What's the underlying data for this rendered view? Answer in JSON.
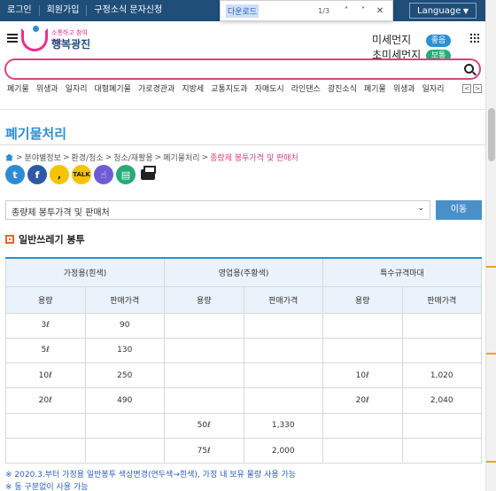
{
  "topbar": {
    "links": [
      "로그인",
      "회원가입",
      "구정소식 문자신청"
    ],
    "language": "Language"
  },
  "find_bar": {
    "query": "다운로드",
    "count": "1/3"
  },
  "header": {
    "logo_sub": "소통하고 참여하는",
    "logo_name": "행복광진",
    "fine_dust": "미세먼지",
    "fine_dust_status": "좋음",
    "ultra_fine_dust": "초미세먼지",
    "ultra_fine_dust_status": "보통"
  },
  "search": {
    "value": "",
    "placeholder": ""
  },
  "keywords": [
    "폐기물",
    "위생과",
    "일자리",
    "대형폐기물",
    "가로경관과",
    "지방세",
    "교통지도과",
    "자매도시",
    "라인댄스",
    "광진소식",
    "폐기물",
    "위생과",
    "일자리"
  ],
  "page": {
    "title": "폐기물처리",
    "breadcrumb": [
      "분야별정보",
      "환경/청소",
      "청소/재활용",
      "폐기물처리"
    ],
    "breadcrumb_current": "종량제 봉투가격 및 판매처",
    "select_value": "종량제 봉투가격 및 판매처",
    "go_button": "이동",
    "section_title": "일반쓰레기 봉투"
  },
  "table": {
    "groups": [
      "가정용(흰색)",
      "영업용(주황색)",
      "특수규격마대"
    ],
    "subheaders": [
      "용량",
      "판매가격",
      "용량",
      "판매가격",
      "용량",
      "판매가격"
    ],
    "rows": [
      [
        "3ℓ",
        "90",
        "",
        "",
        "",
        ""
      ],
      [
        "5ℓ",
        "130",
        "",
        "",
        "",
        ""
      ],
      [
        "10ℓ",
        "250",
        "",
        "",
        "10ℓ",
        "1,020"
      ],
      [
        "20ℓ",
        "490",
        "",
        "",
        "20ℓ",
        "2,040"
      ],
      [
        "",
        "",
        "50ℓ",
        "1,330",
        "",
        ""
      ],
      [
        "",
        "",
        "75ℓ",
        "2,000",
        "",
        ""
      ]
    ]
  },
  "notes": [
    "※ 2020.3.부터 가정용 일반봉투 색상변경(연두색→흰색), 가정 내 보유 물량 사용 가능",
    "※ 동 구분없이 사용 가능"
  ]
}
